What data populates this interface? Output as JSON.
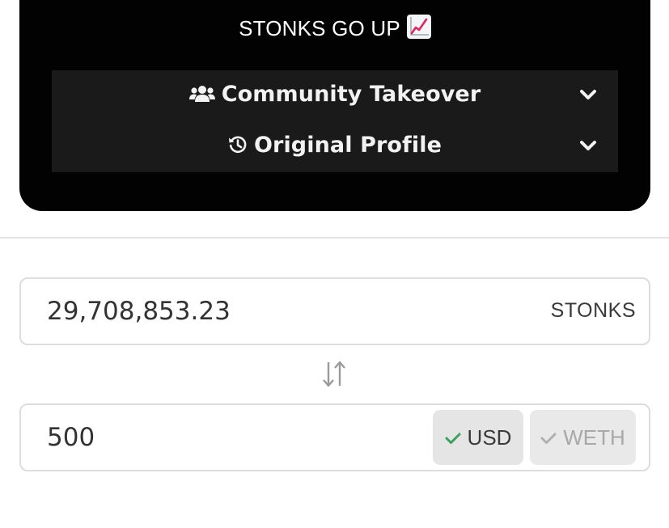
{
  "card": {
    "title": "STONKS GO UP",
    "title_emoji_icon": "chart-increasing-icon",
    "accordion": [
      {
        "label": "Community Takeover",
        "icon": "users-icon",
        "chevron": "chevron-down-icon"
      },
      {
        "label": "Original Profile",
        "icon": "history-icon",
        "chevron": "chevron-down-icon"
      }
    ]
  },
  "swap": {
    "from": {
      "value": "29,708,853.23",
      "token": "STONKS"
    },
    "swap_icon": "swap-arrows-icon",
    "to": {
      "value": "500"
    },
    "currencies": [
      {
        "label": "USD",
        "selected": true,
        "check_color": "#3aa05c"
      },
      {
        "label": "WETH",
        "selected": false,
        "check_color": "#b0b0b0"
      }
    ]
  }
}
